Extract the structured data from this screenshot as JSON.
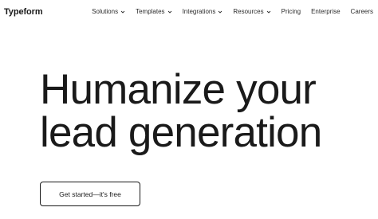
{
  "header": {
    "logo": "Typeform",
    "nav": [
      {
        "label": "Solutions",
        "dropdown": true
      },
      {
        "label": "Templates",
        "dropdown": true
      },
      {
        "label": "Integrations",
        "dropdown": true
      },
      {
        "label": "Resources",
        "dropdown": true
      },
      {
        "label": "Pricing",
        "dropdown": false
      },
      {
        "label": "Enterprise",
        "dropdown": false
      },
      {
        "label": "Careers",
        "dropdown": false
      }
    ]
  },
  "hero": {
    "line1": "Humanize your",
    "line2": "lead generation",
    "cta_label": "Get started—it's free"
  },
  "colors": {
    "text": "#1a1a1a",
    "background": "#ffffff"
  },
  "icons": {
    "dropdown": "chevron-down-icon"
  }
}
